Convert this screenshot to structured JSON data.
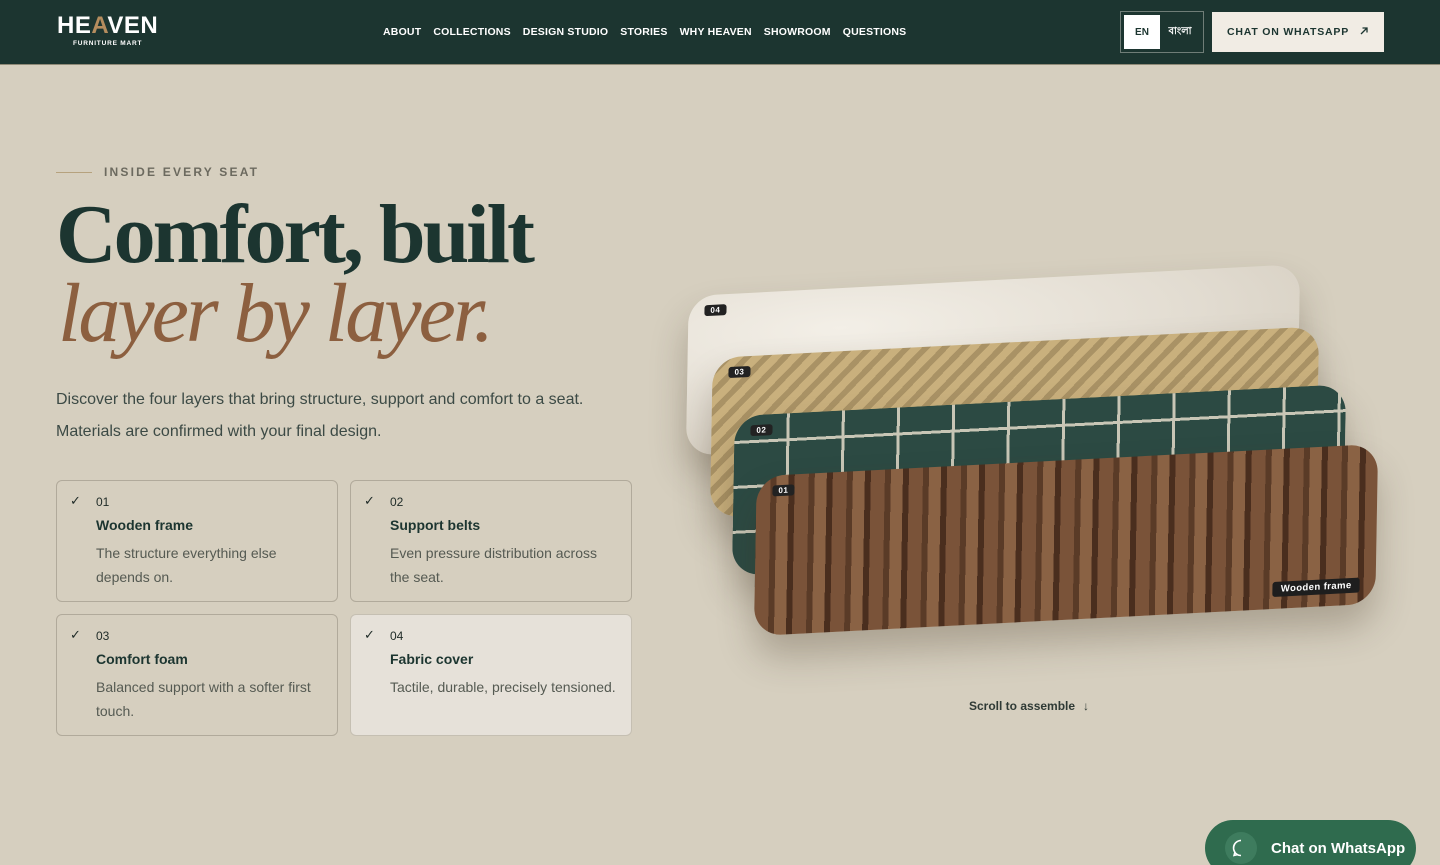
{
  "header": {
    "logo": {
      "word_start": "HE",
      "word_accent": "A",
      "word_end": "VEN",
      "tagline": "FURNITURE MART"
    },
    "nav": [
      "ABOUT",
      "COLLECTIONS",
      "DESIGN STUDIO",
      "STORIES",
      "WHY HEAVEN",
      "SHOWROOM",
      "QUESTIONS"
    ],
    "lang": {
      "active": "EN",
      "other": "বাংলা"
    },
    "cta": {
      "label": "CHAT ON WHATSAPP",
      "icon": "arrow-up-right-icon"
    }
  },
  "hero": {
    "eyebrow": "INSIDE EVERY SEAT",
    "title_line1": "Comfort, built",
    "title_line2": "layer by layer.",
    "description": "Discover the four layers that bring structure, support and comfort to a seat. Materials are confirmed with your final design."
  },
  "layers": [
    {
      "num": "01",
      "title": "Wooden frame",
      "body": "The structure everything else depends on.",
      "active": false
    },
    {
      "num": "02",
      "title": "Support belts",
      "body": "Even pressure distribution across the seat.",
      "active": false
    },
    {
      "num": "03",
      "title": "Comfort foam",
      "body": "Balanced support with a softer first touch.",
      "active": false
    },
    {
      "num": "04",
      "title": "Fabric cover",
      "body": "Tactile, durable, precisely tensioned.",
      "active": true
    }
  ],
  "illustration": {
    "tags": [
      "04",
      "03",
      "02",
      "01"
    ],
    "frame_label": "Wooden frame",
    "scroll_hint": "Scroll to assemble",
    "scroll_icon": "arrow-down-icon"
  },
  "floating": {
    "label": "Chat on WhatsApp",
    "icon": "chat-bubble-icon"
  },
  "colors": {
    "header_bg": "#1c3530",
    "page_bg": "#d6cfbf",
    "accent_brown": "#8c5f3f",
    "whatsapp_green": "#2f6b4e"
  }
}
